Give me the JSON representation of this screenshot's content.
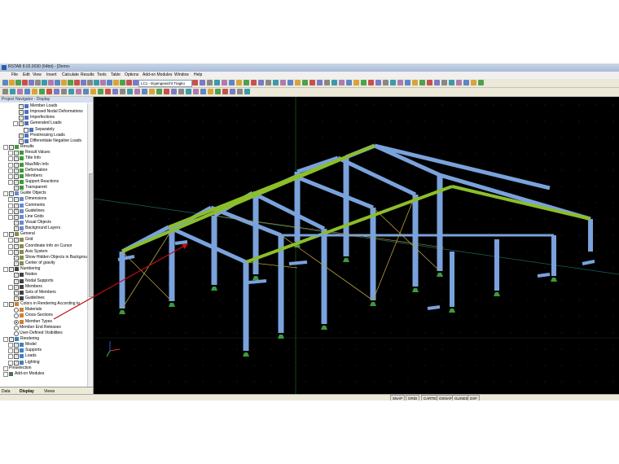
{
  "app": {
    "title": "RSTAB 8.02.0030 (64bit) - [Demo-"
  },
  "menu": [
    "File",
    "Edit",
    "View",
    "Insert",
    "Calculate",
    "Results",
    "Tools",
    "Table",
    "Options",
    "Add-on Modules",
    "Window",
    "Help"
  ],
  "toolbar": {
    "load_case_select": "LC1 - Eigengewicht Tragko"
  },
  "navigator": {
    "title": "Project Navigator - Display",
    "tabs": [
      "Data",
      "Display",
      "Views"
    ],
    "items": [
      {
        "label": "Member Loads",
        "level": 2,
        "exp": false,
        "control": "check",
        "checked": true,
        "icon": "load"
      },
      {
        "label": "Imposed Nodal Deformations",
        "level": 2,
        "exp": false,
        "control": "check",
        "checked": true,
        "icon": "load"
      },
      {
        "label": "Imperfections",
        "level": 2,
        "exp": false,
        "control": "check",
        "checked": true,
        "icon": "load"
      },
      {
        "label": "Generated Loads",
        "level": 2,
        "exp": true,
        "control": "check",
        "checked": true,
        "icon": "load"
      },
      {
        "label": "Separately",
        "level": 3,
        "exp": false,
        "control": "check",
        "checked": false,
        "icon": "load"
      },
      {
        "label": "Prestressing Loads",
        "level": 2,
        "exp": false,
        "control": "check",
        "checked": true,
        "icon": "load"
      },
      {
        "label": "Differentiate Negative Loads",
        "level": 2,
        "exp": false,
        "control": "check",
        "checked": true,
        "icon": "load"
      },
      {
        "label": "Results",
        "level": 0,
        "exp": true,
        "control": "check",
        "checked": true,
        "icon": "green"
      },
      {
        "label": "Result Values",
        "level": 1,
        "exp": true,
        "control": "check",
        "checked": true,
        "icon": "green"
      },
      {
        "label": "Title Info",
        "level": 1,
        "exp": true,
        "control": "check",
        "checked": true,
        "icon": "green"
      },
      {
        "label": "Max/Min Info",
        "level": 1,
        "exp": true,
        "control": "check",
        "checked": true,
        "icon": "green"
      },
      {
        "label": "Deformation",
        "level": 1,
        "exp": true,
        "control": "check",
        "checked": true,
        "icon": "green"
      },
      {
        "label": "Members",
        "level": 1,
        "exp": true,
        "control": "check",
        "checked": true,
        "icon": "green"
      },
      {
        "label": "Support Reactions",
        "level": 1,
        "exp": true,
        "control": "check",
        "checked": true,
        "icon": "green"
      },
      {
        "label": "Transparent",
        "level": 1,
        "exp": false,
        "control": "check",
        "checked": true,
        "icon": "green"
      },
      {
        "label": "Guide Objects",
        "level": 0,
        "exp": true,
        "control": "check",
        "checked": true,
        "icon": "guide"
      },
      {
        "label": "Dimensions",
        "level": 1,
        "exp": true,
        "control": "check",
        "checked": true,
        "icon": "guide"
      },
      {
        "label": "Comments",
        "level": 1,
        "exp": true,
        "control": "check",
        "checked": true,
        "icon": "guide"
      },
      {
        "label": "Guidelines",
        "level": 1,
        "exp": true,
        "control": "check",
        "checked": true,
        "icon": "guide"
      },
      {
        "label": "Line Grids",
        "level": 1,
        "exp": true,
        "control": "check",
        "checked": true,
        "icon": "guide"
      },
      {
        "label": "Visual Objects",
        "level": 1,
        "exp": false,
        "control": "check",
        "checked": true,
        "icon": "guide"
      },
      {
        "label": "Background Layers",
        "level": 1,
        "exp": false,
        "control": "check",
        "checked": true,
        "icon": "guide"
      },
      {
        "label": "General",
        "level": 0,
        "exp": true,
        "control": "check",
        "checked": true,
        "icon": "gen"
      },
      {
        "label": "Grid",
        "level": 1,
        "exp": true,
        "control": "check",
        "checked": true,
        "icon": "gen"
      },
      {
        "label": "Coordinate Info on Cursor",
        "level": 1,
        "exp": true,
        "control": "check",
        "checked": true,
        "icon": "gen"
      },
      {
        "label": "Axis System",
        "level": 1,
        "exp": true,
        "control": "check",
        "checked": true,
        "icon": "gen"
      },
      {
        "label": "Show Hidden Objects in Backgrou",
        "level": 1,
        "exp": false,
        "control": "check",
        "checked": true,
        "icon": "gen"
      },
      {
        "label": "Center of gravity",
        "level": 1,
        "exp": false,
        "control": "check",
        "checked": true,
        "icon": "gen"
      },
      {
        "label": "Numbering",
        "level": 0,
        "exp": true,
        "control": "check",
        "checked": true,
        "icon": "num"
      },
      {
        "label": "Nodes",
        "level": 1,
        "exp": false,
        "control": "check",
        "checked": true,
        "icon": "num"
      },
      {
        "label": "Nodal Supports",
        "level": 1,
        "exp": false,
        "control": "check",
        "checked": true,
        "icon": "num"
      },
      {
        "label": "Members",
        "level": 1,
        "exp": true,
        "control": "check",
        "checked": true,
        "icon": "num"
      },
      {
        "label": "Sets of Members",
        "level": 1,
        "exp": false,
        "control": "check",
        "checked": true,
        "icon": "num"
      },
      {
        "label": "Guidelines",
        "level": 1,
        "exp": false,
        "control": "check",
        "checked": true,
        "icon": "num"
      },
      {
        "label": "Colors in Rendering According to",
        "level": 0,
        "exp": true,
        "control": "check",
        "checked": true,
        "icon": "color"
      },
      {
        "label": "Materials",
        "level": 1,
        "exp": false,
        "control": "radio",
        "checked": false,
        "icon": "color"
      },
      {
        "label": "Cross-Sections",
        "level": 1,
        "exp": false,
        "control": "radio",
        "checked": false,
        "icon": "color"
      },
      {
        "label": "Member Types",
        "level": 1,
        "exp": false,
        "control": "radio",
        "checked": true,
        "icon": "color"
      },
      {
        "label": "Member End Releases",
        "level": 1,
        "exp": false,
        "control": "radio",
        "checked": false,
        "icon": "none"
      },
      {
        "label": "User-Defined Visibilities",
        "level": 1,
        "exp": false,
        "control": "radio",
        "checked": false,
        "icon": "none"
      },
      {
        "label": "Rendering",
        "level": 0,
        "exp": true,
        "control": "check",
        "checked": true,
        "icon": "render"
      },
      {
        "label": "Model",
        "level": 1,
        "exp": true,
        "control": "check",
        "checked": true,
        "icon": "render"
      },
      {
        "label": "Supports",
        "level": 1,
        "exp": true,
        "control": "check",
        "checked": true,
        "icon": "render"
      },
      {
        "label": "Loads",
        "level": 1,
        "exp": true,
        "control": "check",
        "checked": true,
        "icon": "render"
      },
      {
        "label": "Lighting",
        "level": 1,
        "exp": true,
        "control": "check",
        "checked": true,
        "icon": "render"
      },
      {
        "label": "Preselection",
        "level": 0,
        "exp": true,
        "control": "none",
        "checked": false,
        "icon": "none"
      },
      {
        "label": "Add-on Modules",
        "level": 0,
        "exp": true,
        "control": "none",
        "checked": false,
        "icon": "addon"
      }
    ]
  },
  "statusbar": [
    "SNAP",
    "GRID",
    "CARTES",
    "OSNAP",
    "GLINES",
    "DXF"
  ],
  "colors": {
    "column": "#7aa2dc",
    "beam_green": "#8cbe2a",
    "annotation_arrow": "#c01010",
    "viewport_bg": "#000000"
  }
}
